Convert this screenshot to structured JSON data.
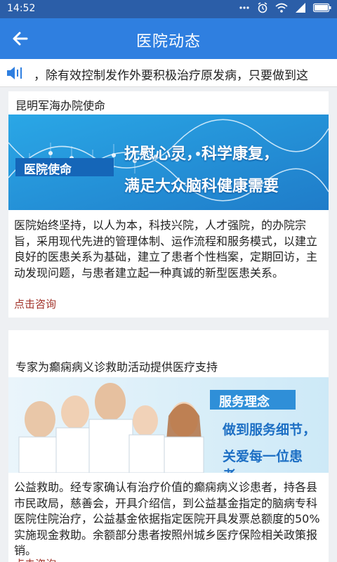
{
  "status_bar": {
    "time": "14:52",
    "icons": [
      "dots-icon",
      "alarm-icon",
      "wifi-icon",
      "signal-icon",
      "battery-icon"
    ]
  },
  "app_bar": {
    "back_icon": "back-arrow-icon",
    "title": "医院动态"
  },
  "ticker": {
    "icon": "speaker-icon",
    "text": "，除有效控制发作外要积极治疗原发病，只要做到这"
  },
  "articles": [
    {
      "title": "昆明军海办院使命",
      "banner": {
        "tag": "医院使命",
        "line1": "抚慰心灵，科学康复，",
        "line2": "满足大众脑科健康需要"
      },
      "body": "医院始终坚持，以人为本，科技兴院，人才强院，的办院宗旨，采用现代先进的管理体制、运作流程和服务模式，以建立良好的医患关系为基础，建立了患者个性档案，定期回访，主动发现问题，与患者建立起一种真诚的新型医患关系。",
      "link": "点击咨询"
    },
    {
      "title": "专家为癫痫病义诊救助活动提供医疗支持",
      "banner": {
        "tag": "服务理念",
        "line1": "做到服务细节，",
        "line2": "关爱每一位患者。"
      },
      "body": "公益救助。经专家确认有治疗价值的癫痫病义诊患者，持各县市民政局，慈善会，开具介绍信，到公益基金指定的脑病专科医院住院治疗，公益基金依据指定医院开具发票总额度的50%实施现金救助。余额部分患者按照州城乡医疗保险相关政策报销。",
      "link": "点击咨询"
    }
  ],
  "colors": {
    "status_bar": "#2b5ea8",
    "app_bar": "#2f7fe0",
    "link": "#a2332a"
  }
}
